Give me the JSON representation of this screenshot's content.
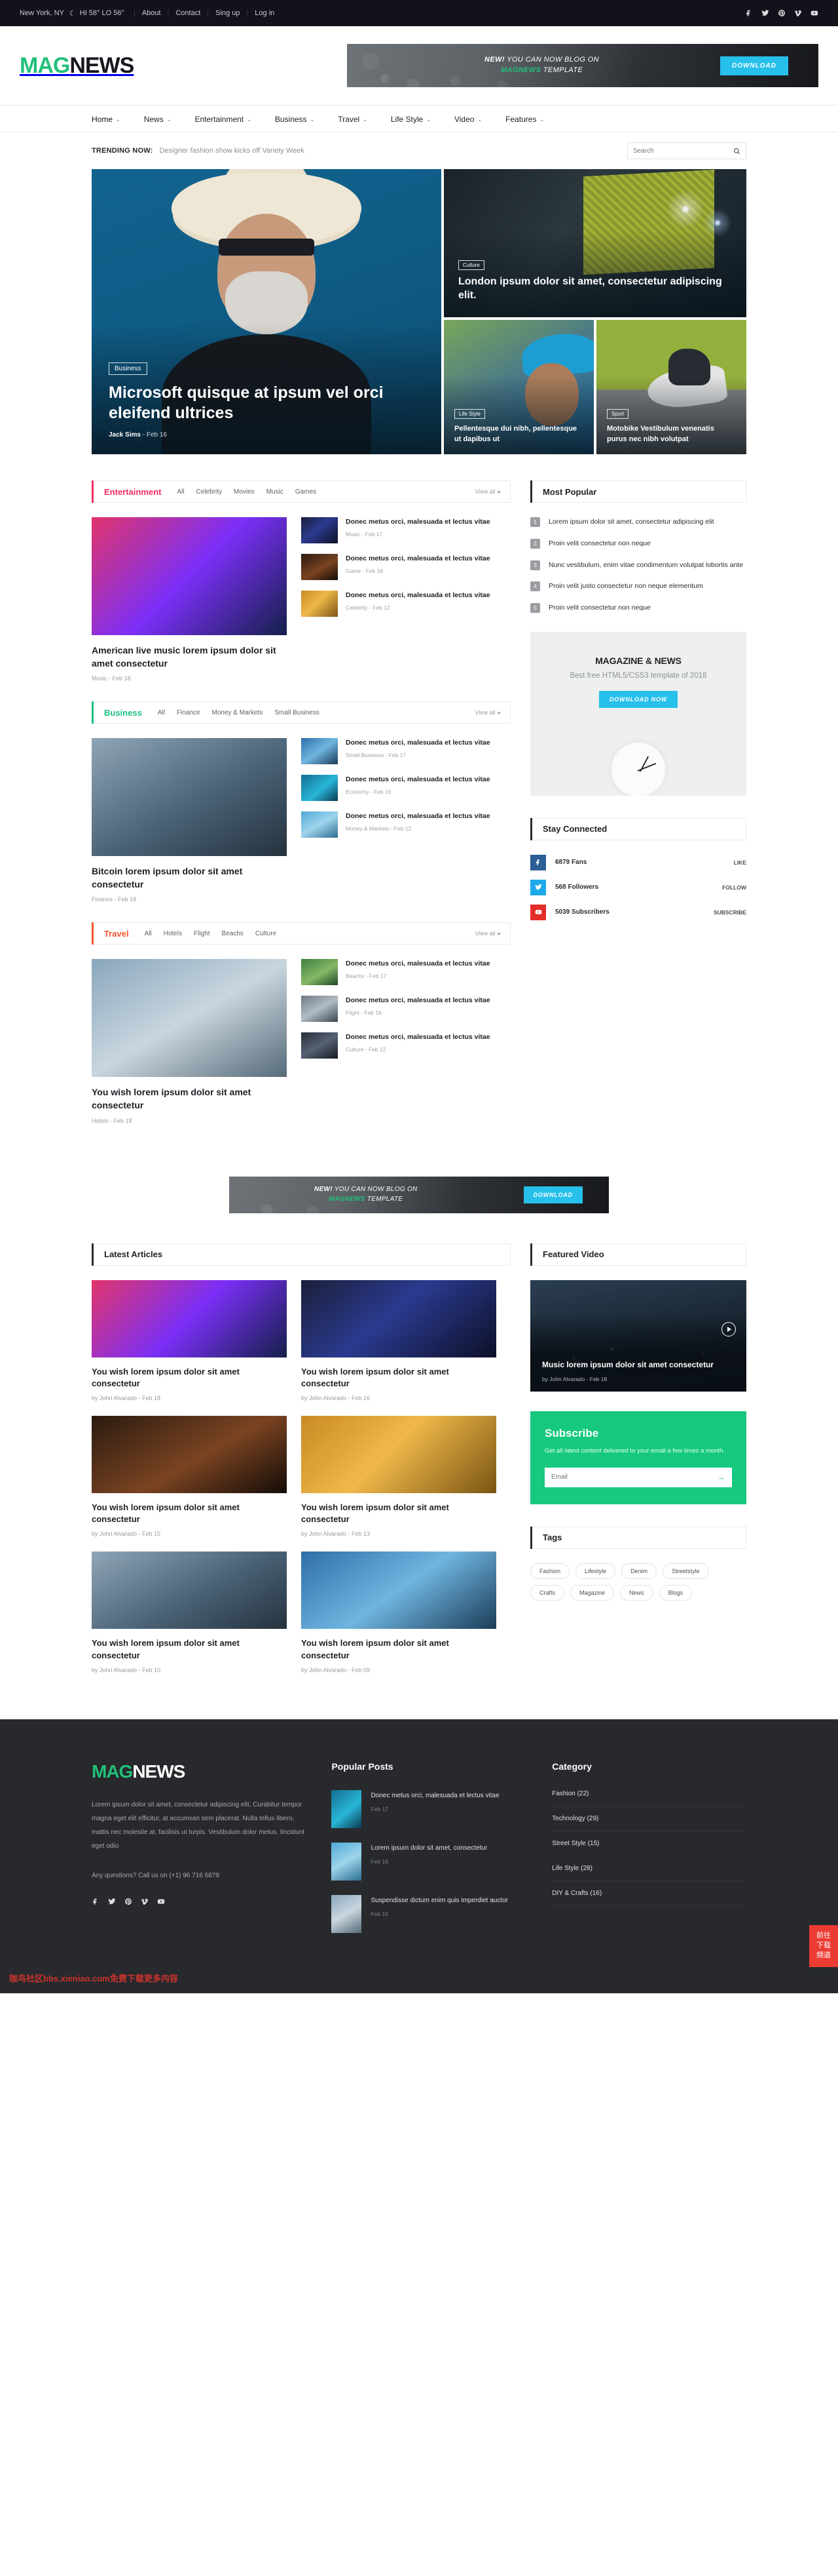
{
  "topbar": {
    "location": "New York, NY",
    "weather": "HI 58° LO 56°",
    "links": [
      "About",
      "Contact",
      "Sing up",
      "Log in"
    ],
    "socials": [
      "facebook-icon",
      "twitter-icon",
      "pinterest-icon",
      "vimeo-icon",
      "youtube-icon"
    ]
  },
  "brand": {
    "mag": "MAG",
    "news": "NEWS"
  },
  "header_ad": {
    "line1_strong": "NEW!",
    "line1_rest": " YOU CAN NOW BLOG ON",
    "line2_strong": "MAGNEWS",
    "line2_rest": " TEMPLATE",
    "button": "DOWNLOAD"
  },
  "nav": [
    {
      "label": "Home",
      "active": true
    },
    {
      "label": "News",
      "active": false
    },
    {
      "label": "Entertainment",
      "active": false
    },
    {
      "label": "Business",
      "active": false
    },
    {
      "label": "Travel",
      "active": false
    },
    {
      "label": "Life Style",
      "active": false
    },
    {
      "label": "Video",
      "active": false
    },
    {
      "label": "Features",
      "active": false
    }
  ],
  "trending": {
    "label": "TRENDING NOW:",
    "text": "Designer fashion show kicks off Variety Week",
    "search_placeholder": "Search"
  },
  "hero": {
    "main": {
      "category": "Business",
      "title": "Microsoft quisque at ipsum vel orci eleifend ultrices",
      "author": "Jack Sims",
      "sep": "-",
      "date": "Feb 16"
    },
    "top": {
      "category": "Culture",
      "title": "London ipsum dolor sit amet, consectetur adipiscing elit."
    },
    "sub": [
      {
        "category": "Life Style",
        "title": "Pellentesque dui nibh, pellentesque ut dapibus ut"
      },
      {
        "category": "Sport",
        "title": "Motobike Vestibulum venenatis purus nec nibh volutpat"
      }
    ]
  },
  "sections": [
    {
      "title": "Entertainment",
      "accent": "#ef2e63",
      "tabs": [
        "All",
        "Celebrity",
        "Movies",
        "Music",
        "Games"
      ],
      "view_all": "View all",
      "feature": {
        "title": "American live music lorem ipsum dolor sit amet consectetur",
        "category": "Music",
        "date": "Feb 18"
      },
      "items": [
        {
          "title": "Donec metus orci, malesuada et lectus vitae",
          "category": "Music",
          "date": "Feb 17"
        },
        {
          "title": "Donec metus orci, malesuada et lectus vitae",
          "category": "Game",
          "date": "Feb 16"
        },
        {
          "title": "Donec metus orci, malesuada et lectus vitae",
          "category": "Celebrity",
          "date": "Feb 12"
        }
      ]
    },
    {
      "title": "Business",
      "accent": "#1bbf7e",
      "tabs": [
        "All",
        "Finance",
        "Money & Markets",
        "Small Business"
      ],
      "view_all": "View all",
      "feature": {
        "title": "Bitcoin lorem ipsum dolor sit amet consectetur",
        "category": "Finance",
        "date": "Feb 18"
      },
      "items": [
        {
          "title": "Donec metus orci, malesuada et lectus vitae",
          "category": "Small Business",
          "date": "Feb 17"
        },
        {
          "title": "Donec metus orci, malesuada et lectus vitae",
          "category": "Economy",
          "date": "Feb 16"
        },
        {
          "title": "Donec metus orci, malesuada et lectus vitae",
          "category": "Money & Markets",
          "date": "Feb 12"
        }
      ]
    },
    {
      "title": "Travel",
      "accent": "#f2562f",
      "tabs": [
        "All",
        "Hotels",
        "Flight",
        "Beachs",
        "Culture"
      ],
      "view_all": "View all",
      "feature": {
        "title": "You wish lorem ipsum dolor sit amet consectetur",
        "category": "Hotels",
        "date": "Feb 18"
      },
      "items": [
        {
          "title": "Donec metus orci, malesuada et lectus vitae",
          "category": "Beachs",
          "date": "Feb 17"
        },
        {
          "title": "Donec metus orci, malesuada et lectus vitae",
          "category": "Flight",
          "date": "Feb 16"
        },
        {
          "title": "Donec metus orci, malesuada et lectus vitae",
          "category": "Culture",
          "date": "Feb 12"
        }
      ]
    }
  ],
  "most_popular": {
    "title": "Most Popular",
    "items": [
      {
        "num": "1",
        "text": "Lorem ipsum dolor sit amet, consectetur adipiscing elit"
      },
      {
        "num": "2",
        "text": "Proin velit consectetur non neque"
      },
      {
        "num": "3",
        "text": "Nunc vestibulum, enim vitae condimentum volutpat lobortis ante"
      },
      {
        "num": "4",
        "text": "Proin velit justo consectetur non neque elementum"
      },
      {
        "num": "5",
        "text": "Proin velit consectetur non neque"
      }
    ]
  },
  "side_ad": {
    "title": "MAGAZINE & NEWS",
    "subtitle": "Best free HTML5/CSS3 template of 2018",
    "button": "DOWNLOAD NOW"
  },
  "stay_connected": {
    "title": "Stay Connected",
    "rows": [
      {
        "icon": "facebook-icon",
        "color": "#2d5e96",
        "count": "6879 Fans",
        "action": "LIKE"
      },
      {
        "icon": "twitter-icon",
        "color": "#1da9e9",
        "count": "568 Followers",
        "action": "FOLLOW"
      },
      {
        "icon": "youtube-icon",
        "color": "#e52d27",
        "count": "5039 Subscribers",
        "action": "SUBSCRIBE"
      }
    ]
  },
  "mid_ad": {
    "line1_strong": "NEW!",
    "line1_rest": " YOU CAN NOW BLOG ON",
    "line2_strong": "MAGNEWS",
    "line2_rest": " TEMPLATE",
    "button": "DOWNLOAD"
  },
  "latest": {
    "title": "Latest Articles",
    "cards": [
      {
        "title": "You wish lorem ipsum dolor sit amet consectetur",
        "meta": "by John Alvarado  -  Feb 18"
      },
      {
        "title": "You wish lorem ipsum dolor sit amet consectetur",
        "meta": "by John Alvarado  -  Feb 16"
      },
      {
        "title": "You wish lorem ipsum dolor sit amet consectetur",
        "meta": "by John Alvarado  -  Feb 15"
      },
      {
        "title": "You wish lorem ipsum dolor sit amet consectetur",
        "meta": "by John Alvarado  -  Feb 13"
      },
      {
        "title": "You wish lorem ipsum dolor sit amet consectetur",
        "meta": "by John Alvarado  -  Feb 10"
      },
      {
        "title": "You wish lorem ipsum dolor sit amet consectetur",
        "meta": "by John Alvarado  -  Feb 09"
      }
    ]
  },
  "featured_video": {
    "title": "Featured Video",
    "video_title": "Music lorem ipsum dolor sit amet consectetur",
    "video_meta": "by John Alvarado  -  Feb 18"
  },
  "subscribe": {
    "title": "Subscribe",
    "text": "Get all latest content delivered to your email a few times a month.",
    "placeholder": "Email",
    "arrow": "→"
  },
  "tags": {
    "title": "Tags",
    "items": [
      "Fashion",
      "Lifestyle",
      "Denim",
      "Streetstyle",
      "Crafts",
      "Magazine",
      "News",
      "Blogs"
    ]
  },
  "footer": {
    "about_text": "Lorem ipsum dolor sit amet, consectetur adipiscing elit. Curabitur tempor magna eget elit efficitur, at accumsan sem placerat. Nulla tellus libero, mattis nec molestie at, facilisis ut turpis. Vestibulum dolor metus, tincidunt eget odio",
    "phone_text": "Any questions? Call us on (+1) 96 716 6879",
    "socials": [
      "facebook-icon",
      "twitter-icon",
      "pinterest-icon",
      "vimeo-icon",
      "youtube-icon"
    ],
    "popular_title": "Popular Posts",
    "popular_posts": [
      {
        "title": "Donec metus orci, malesuada et lectus vitae",
        "date": "Feb 17"
      },
      {
        "title": "Lorem ipsum dolor sit amet, consectetur",
        "date": "Feb 16"
      },
      {
        "title": "Suspendisse dictum enim quis imperdiet auctor",
        "date": "Feb 15"
      }
    ],
    "category_title": "Category",
    "categories": [
      "Fashion (22)",
      "Technology (29)",
      "Street Style (15)",
      "Life Style (28)",
      "DIY & Crafts (16)"
    ]
  },
  "overlay": {
    "watermark": "咖鸟社区bbs.xieniao.com免费下载更多内容",
    "float_button": "前往下载频道"
  }
}
